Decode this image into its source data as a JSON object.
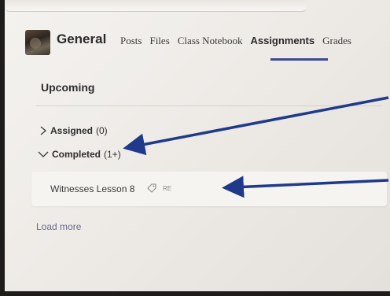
{
  "header": {
    "channel_name": "General",
    "tabs": [
      {
        "label": "Posts",
        "active": false
      },
      {
        "label": "Files",
        "active": false
      },
      {
        "label": "Class Notebook",
        "active": false
      },
      {
        "label": "Assignments",
        "active": true
      },
      {
        "label": "Grades",
        "active": false
      }
    ]
  },
  "main": {
    "section_title": "Upcoming",
    "groups": [
      {
        "label": "Assigned",
        "count": "(0)",
        "expanded": false
      },
      {
        "label": "Completed",
        "count": "(1+)",
        "expanded": true
      }
    ],
    "assignment": {
      "title": "Witnesses Lesson 8",
      "tag": "RE"
    },
    "load_more": "Load more"
  },
  "colors": {
    "accent": "#3e4a8f",
    "annotation_arrow": "#1f3a8a"
  },
  "icons": {
    "collapsed_chevron": "chevron-right-icon",
    "expanded_chevron": "chevron-down-icon",
    "tag": "tag-icon"
  }
}
